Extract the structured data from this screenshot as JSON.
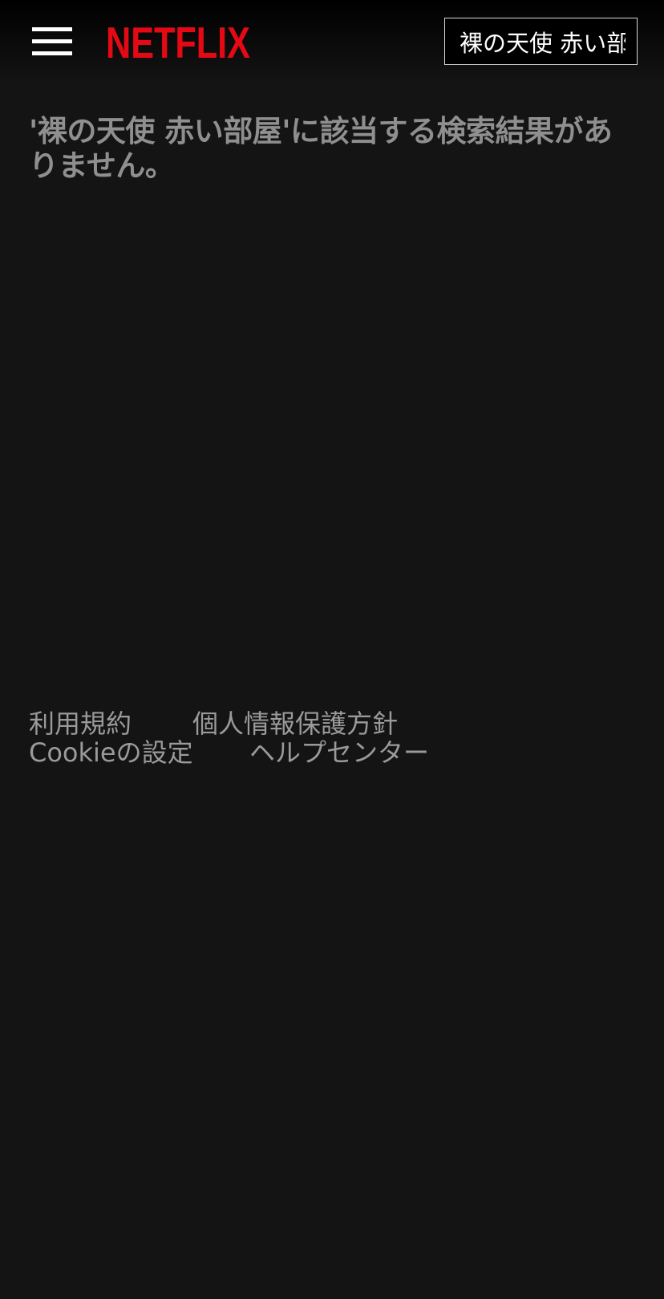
{
  "header": {
    "menu_icon": "hamburger-menu-icon",
    "logo_text": "NETFLIX",
    "logo_color": "#e50914",
    "search": {
      "value": "裸の天使 赤い部屋",
      "placeholder": ""
    }
  },
  "main": {
    "no_results_message": "'裸の天使 赤い部屋'に該当する検索結果がありません。"
  },
  "footer": {
    "links": [
      "利用規約",
      "個人情報保護方針",
      "Cookieの設定",
      "ヘルプセンター"
    ]
  },
  "colors": {
    "background": "#141414",
    "text_muted": "#8f8f8f",
    "brand_red": "#e50914"
  }
}
